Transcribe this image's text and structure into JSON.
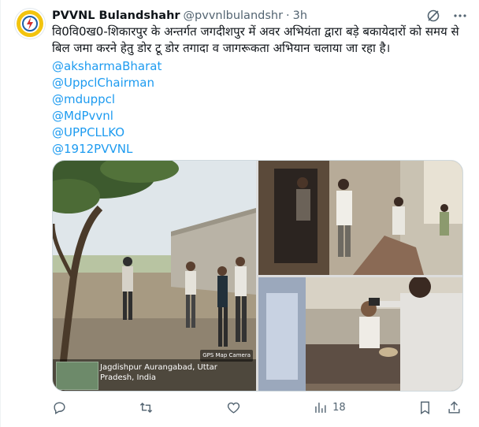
{
  "account": {
    "display_name": "PVVNL Bulandshahr",
    "handle": "@pvvnlbulandshr",
    "separator": "·",
    "time_ago": "3h"
  },
  "tweet": {
    "text": "वि0वि0ख0-शिकारपुर के अन्तर्गत जगदीशपुर में अवर अभियंता द्वारा बड़े बकायेदारों को समय से बिल जमा करने हेतु डोर टू डोर तगादा व जागरूकता अभियान चलाया जा रहा है।",
    "mentions": [
      "@aksharmaBharat",
      "@UppclChairman",
      "@mduppcl",
      "@MdPvvnl",
      "@UPPCLLKO",
      "@1912PVVNL"
    ]
  },
  "media": {
    "gps_overlay": {
      "location": "Jagdishpur Aurangabad, Uttar Pradesh, India",
      "badge": "GPS Map Camera"
    }
  },
  "actions": {
    "views_count": "18"
  },
  "colors": {
    "accent": "#1d9bf0",
    "secondary_text": "#536471",
    "primary_text": "#0f1419"
  },
  "icons": [
    "grok-icon",
    "more-icon",
    "reply-icon",
    "retweet-icon",
    "like-icon",
    "views-icon",
    "bookmark-icon",
    "share-icon"
  ]
}
